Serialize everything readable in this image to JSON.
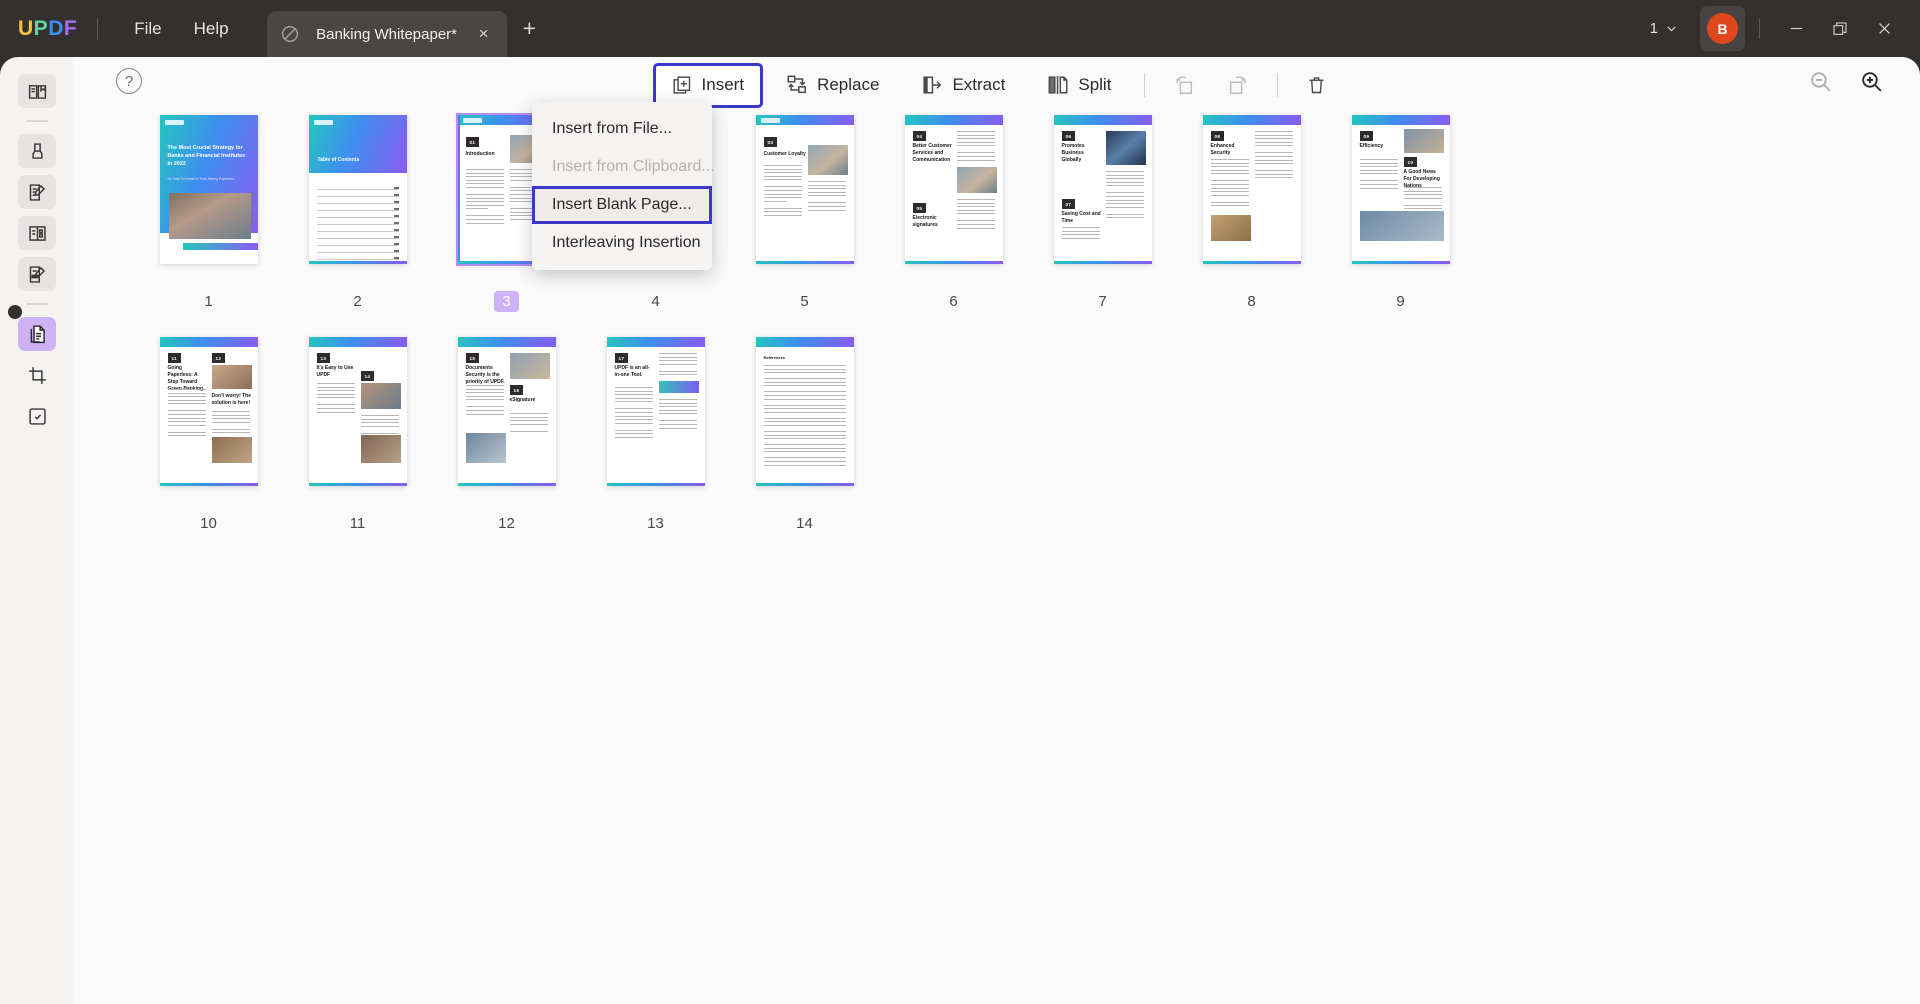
{
  "app": {
    "logo_letters": [
      "U",
      "P",
      "D",
      "F"
    ],
    "menus": [
      {
        "label": "File",
        "name": "file-menu"
      },
      {
        "label": "Help",
        "name": "help-menu"
      }
    ],
    "tab": {
      "title": "Banking Whitepaper*",
      "icon": "document-slash-icon",
      "close_label": "×",
      "new_tab_label": "+"
    },
    "window": {
      "page_count": "1",
      "chevron": "⌄",
      "avatar_initial": "B",
      "minimize": "—",
      "restore": "restore-icon",
      "close": "×"
    },
    "colors": {
      "accent_blue": "#3b37c9",
      "accent_purple": "#cdb3f5",
      "avatar_red": "#e1471d",
      "titlebar": "#33302f"
    }
  },
  "sidebar": {
    "items": [
      {
        "name": "sidebar-item-reading",
        "icon": "book-bookmark-icon",
        "active": false
      },
      {
        "name": "sidebar-item-highlight",
        "icon": "marker-pen-icon",
        "active": false
      },
      {
        "name": "sidebar-item-edit",
        "icon": "edit-document-icon",
        "active": false
      },
      {
        "name": "sidebar-item-form",
        "icon": "form-fields-icon",
        "active": false
      },
      {
        "name": "sidebar-item-sign",
        "icon": "sign-document-icon",
        "active": false
      },
      {
        "name": "sidebar-item-organize",
        "icon": "organize-pages-icon",
        "active": true
      },
      {
        "name": "sidebar-item-crop",
        "icon": "crop-page-icon",
        "active": false
      },
      {
        "name": "sidebar-item-protect",
        "icon": "protect-page-icon",
        "active": false
      }
    ]
  },
  "toolbar": {
    "help_icon": "question-mark-icon",
    "tools": [
      {
        "label": "Insert",
        "icon": "insert-page-icon",
        "name": "insert-tool",
        "state": "selected"
      },
      {
        "label": "Replace",
        "icon": "replace-page-icon",
        "name": "replace-tool",
        "state": "normal"
      },
      {
        "label": "Extract",
        "icon": "extract-page-icon",
        "name": "extract-tool",
        "state": "normal"
      },
      {
        "label": "Split",
        "icon": "split-page-icon",
        "name": "split-tool",
        "state": "normal"
      }
    ],
    "icon_tools": [
      {
        "icon": "rotate-left-icon",
        "name": "rotate-left-button",
        "state": "disabled"
      },
      {
        "icon": "rotate-right-icon",
        "name": "rotate-right-button",
        "state": "disabled"
      },
      {
        "icon": "delete-page-icon",
        "name": "delete-page-button",
        "state": "normal"
      }
    ],
    "zoom_out_icon": "zoom-out-icon",
    "zoom_in_icon": "zoom-in-icon"
  },
  "insert_menu": {
    "items": [
      {
        "label": "Insert from File...",
        "name": "insert-from-file-item",
        "state": "normal"
      },
      {
        "label": "Insert from Clipboard...",
        "name": "insert-from-clipboard-item",
        "state": "disabled"
      },
      {
        "label": "Insert Blank Page...",
        "name": "insert-blank-page-item",
        "state": "highlighted"
      },
      {
        "label": "Interleaving Insertion",
        "name": "interleaving-insertion-item",
        "state": "normal"
      }
    ]
  },
  "pages": {
    "selected_page": "3",
    "rows": [
      [
        {
          "number": "1",
          "kind": "cover",
          "title": "The Most Crucial Strategy for Banks and Financial Institutes in 2022",
          "subtitle": "It's Time To Invest In Time-Saving Paperless",
          "selected": false
        },
        {
          "number": "2",
          "kind": "toc",
          "title": "Table of Contents",
          "selected": false
        },
        {
          "number": "3",
          "kind": "content",
          "badge": "01",
          "heading": "Introduction",
          "selected": true
        },
        {
          "number": "4",
          "kind": "text",
          "selected": false
        },
        {
          "number": "5",
          "kind": "content",
          "badge": "03",
          "heading": "Customer Loyalty",
          "selected": false
        },
        {
          "number": "6",
          "kind": "double",
          "badge": "04",
          "heading": "Better Customer Services and Communication",
          "badge2": "05",
          "heading2": "Electronic signatures",
          "selected": false
        },
        {
          "number": "7",
          "kind": "double",
          "badge": "06",
          "heading": "Promotes Business Globally",
          "badge2": "07",
          "heading2": "Saving Cost and Time",
          "selected": false
        },
        {
          "number": "8",
          "kind": "content",
          "badge": "08",
          "heading": "Enhanced Security",
          "selected": false
        },
        {
          "number": "9",
          "kind": "double",
          "badge": "09",
          "heading": "Efficiency",
          "badge2": "10",
          "heading2": "A Good News For Developing Nations",
          "selected": false
        }
      ],
      [
        {
          "number": "10",
          "kind": "double",
          "badge": "11",
          "heading": "Going Paperless: A Step Toward Green Banking",
          "badge2": "12",
          "heading2": "Don't worry! The solution is here!",
          "selected": false
        },
        {
          "number": "11",
          "kind": "double",
          "badge": "13",
          "heading": "It's Easy to Use UPDF",
          "badge2": "14",
          "heading2": "",
          "selected": false
        },
        {
          "number": "12",
          "kind": "double",
          "badge": "15",
          "heading": "Documents Security is the priority of UPDF.",
          "badge2": "16",
          "heading2": "eSignature",
          "selected": false
        },
        {
          "number": "13",
          "kind": "content",
          "badge": "17",
          "heading": "UPDF is an all-in-one Tool.",
          "selected": false
        },
        {
          "number": "14",
          "kind": "refs",
          "selected": false
        }
      ]
    ]
  }
}
